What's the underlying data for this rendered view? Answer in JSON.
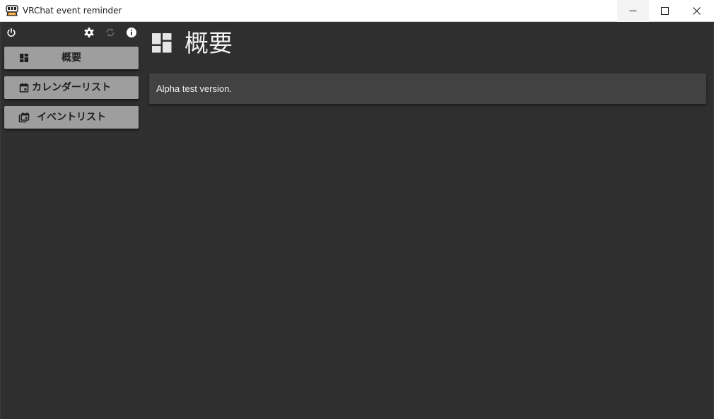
{
  "window": {
    "title": "VRChat event reminder",
    "controls": [
      "minimize",
      "maximize",
      "close"
    ]
  },
  "toolbar": {
    "icons": [
      "power-icon",
      "gear-icon",
      "sync-icon",
      "info-icon"
    ]
  },
  "sidebar": {
    "items": [
      {
        "label": "概要",
        "icon": "dashboard-icon"
      },
      {
        "label": "カレンダーリスト",
        "icon": "calendar-icon"
      },
      {
        "label": "イベントリスト",
        "icon": "event-list-icon"
      }
    ]
  },
  "main": {
    "title": "概要",
    "title_icon": "dashboard-icon",
    "notice": "Alpha test version."
  },
  "colors": {
    "background": "#2f2f2f",
    "card": "#424242",
    "nav_button": "#9e9e9e",
    "titlebar": "#ffffff"
  }
}
